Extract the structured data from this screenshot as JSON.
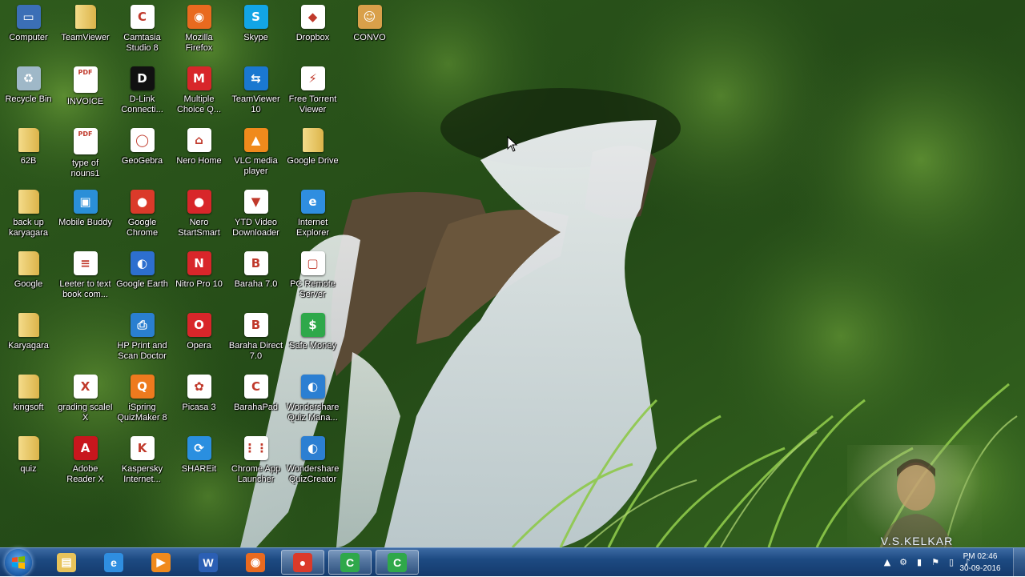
{
  "desktop": {
    "icons": [
      {
        "label": "Computer",
        "icon": "computer-icon",
        "color": "#3b6fb6",
        "glyph": "▭"
      },
      {
        "label": "TeamViewer",
        "icon": "folder-icon",
        "color": "#e8c35a",
        "glyph": ""
      },
      {
        "label": "Camtasia Studio 8",
        "icon": "camtasia-icon",
        "color": "#ffffff",
        "glyph": "C"
      },
      {
        "label": "Mozilla Firefox",
        "icon": "firefox-icon",
        "color": "#e96a1f",
        "glyph": "◉"
      },
      {
        "label": "Skype",
        "icon": "skype-icon",
        "color": "#12a5e6",
        "glyph": "S"
      },
      {
        "label": "Dropbox",
        "icon": "dropbox-icon",
        "color": "#ffffff",
        "glyph": "◆"
      },
      {
        "label": "CONVO",
        "icon": "photo-icon",
        "color": "#d9a04a",
        "glyph": "☺"
      },
      {
        "label": "Recycle Bin",
        "icon": "recycle-bin-icon",
        "color": "#9fb8c8",
        "glyph": "♻"
      },
      {
        "label": "INVOICE",
        "icon": "pdf-icon",
        "color": "#ffffff",
        "glyph": "PDF"
      },
      {
        "label": "D-Link Connecti...",
        "icon": "dlink-icon",
        "color": "#111111",
        "glyph": "D"
      },
      {
        "label": "Multiple Choice Q...",
        "icon": "quiz-icon",
        "color": "#d8262a",
        "glyph": "M"
      },
      {
        "label": "TeamViewer 10",
        "icon": "teamviewer-icon",
        "color": "#1a78d0",
        "glyph": "⇆"
      },
      {
        "label": "Free Torrent Viewer",
        "icon": "torrent-icon",
        "color": "#ffffff",
        "glyph": "⚡"
      },
      {
        "label": "",
        "icon": "",
        "color": "",
        "glyph": ""
      },
      {
        "label": "62B",
        "icon": "folder-icon",
        "color": "#e8c35a",
        "glyph": ""
      },
      {
        "label": "type of nouns1",
        "icon": "pdf-icon",
        "color": "#ffffff",
        "glyph": "PDF"
      },
      {
        "label": "GeoGebra",
        "icon": "geogebra-icon",
        "color": "#ffffff",
        "glyph": "◯"
      },
      {
        "label": "Nero Home",
        "icon": "nero-home-icon",
        "color": "#ffffff",
        "glyph": "⌂"
      },
      {
        "label": "VLC media player",
        "icon": "vlc-icon",
        "color": "#f08a1c",
        "glyph": "▲"
      },
      {
        "label": "Google Drive",
        "icon": "folder-icon",
        "color": "#e8c35a",
        "glyph": ""
      },
      {
        "label": "",
        "icon": "",
        "color": "",
        "glyph": ""
      },
      {
        "label": "back up karyagara",
        "icon": "folder-icon",
        "color": "#e8c35a",
        "glyph": ""
      },
      {
        "label": "Mobile Buddy",
        "icon": "mobile-buddy-icon",
        "color": "#2a8fd8",
        "glyph": "▣"
      },
      {
        "label": "Google Chrome",
        "icon": "chrome-icon",
        "color": "#db3a2a",
        "glyph": "●"
      },
      {
        "label": "Nero StartSmart",
        "icon": "nero-icon",
        "color": "#d8262a",
        "glyph": "●"
      },
      {
        "label": "YTD Video Downloader",
        "icon": "ytd-icon",
        "color": "#ffffff",
        "glyph": "▼"
      },
      {
        "label": "Internet Explorer",
        "icon": "ie-icon",
        "color": "#2f8ee0",
        "glyph": "e"
      },
      {
        "label": "",
        "icon": "",
        "color": "",
        "glyph": ""
      },
      {
        "label": "Google",
        "icon": "folder-icon",
        "color": "#e8c35a",
        "glyph": ""
      },
      {
        "label": "Leeter to text book com...",
        "icon": "document-icon",
        "color": "#ffffff",
        "glyph": "≡"
      },
      {
        "label": "Google Earth",
        "icon": "google-earth-icon",
        "color": "#2d6fcf",
        "glyph": "◐"
      },
      {
        "label": "Nitro Pro 10",
        "icon": "nitro-icon",
        "color": "#d8262a",
        "glyph": "N"
      },
      {
        "label": "Baraha 7.0",
        "icon": "baraha-icon",
        "color": "#ffffff",
        "glyph": "B"
      },
      {
        "label": "PC Remote Server",
        "icon": "pc-remote-icon",
        "color": "#ffffff",
        "glyph": "▢"
      },
      {
        "label": "",
        "icon": "",
        "color": "",
        "glyph": ""
      },
      {
        "label": "Karyagara",
        "icon": "folder-icon",
        "color": "#e8c35a",
        "glyph": ""
      },
      {
        "label": "",
        "icon": "",
        "color": "",
        "glyph": ""
      },
      {
        "label": "HP Print and Scan Doctor",
        "icon": "hp-icon",
        "color": "#2a7fd0",
        "glyph": "⎙"
      },
      {
        "label": "Opera",
        "icon": "opera-icon",
        "color": "#d8262a",
        "glyph": "O"
      },
      {
        "label": "Baraha Direct 7.0",
        "icon": "baraha-direct-icon",
        "color": "#ffffff",
        "glyph": "B"
      },
      {
        "label": "Safe Money",
        "icon": "safe-money-icon",
        "color": "#2ea84a",
        "glyph": "$"
      },
      {
        "label": "",
        "icon": "",
        "color": "",
        "glyph": ""
      },
      {
        "label": "kingsoft",
        "icon": "folder-icon",
        "color": "#e8c35a",
        "glyph": ""
      },
      {
        "label": "grading scaleI X",
        "icon": "excel-icon",
        "color": "#ffffff",
        "glyph": "X"
      },
      {
        "label": "iSpring QuizMaker 8",
        "icon": "ispring-icon",
        "color": "#ee7a1e",
        "glyph": "Q"
      },
      {
        "label": "Picasa 3",
        "icon": "picasa-icon",
        "color": "#ffffff",
        "glyph": "✿"
      },
      {
        "label": "BarahaPad",
        "icon": "barahapad-icon",
        "color": "#ffffff",
        "glyph": "C"
      },
      {
        "label": "Wondershare Quiz Mana...",
        "icon": "wondershare-icon",
        "color": "#2c7fd2",
        "glyph": "◐"
      },
      {
        "label": "",
        "icon": "",
        "color": "",
        "glyph": ""
      },
      {
        "label": "quiz",
        "icon": "folder-icon",
        "color": "#e8c35a",
        "glyph": ""
      },
      {
        "label": "Adobe Reader X",
        "icon": "adobe-reader-icon",
        "color": "#c8161d",
        "glyph": "A"
      },
      {
        "label": "Kaspersky Internet...",
        "icon": "kaspersky-icon",
        "color": "#ffffff",
        "glyph": "K"
      },
      {
        "label": "SHAREit",
        "icon": "shareit-icon",
        "color": "#2a8fe0",
        "glyph": "⟳"
      },
      {
        "label": "Chrome App Launcher",
        "icon": "app-launcher-icon",
        "color": "#ffffff",
        "glyph": "⋮⋮"
      },
      {
        "label": "Wondershare QuizCreator",
        "icon": "quizcreator-icon",
        "color": "#2c7fd2",
        "glyph": "◐"
      },
      {
        "label": "",
        "icon": "",
        "color": "",
        "glyph": ""
      }
    ]
  },
  "taskbar": {
    "pinned": [
      {
        "icon": "file-explorer-icon",
        "color": "#e8c35a",
        "glyph": "▤",
        "active": false
      },
      {
        "icon": "internet-explorer-icon",
        "color": "#2f8ee0",
        "glyph": "e",
        "active": false
      },
      {
        "icon": "media-player-icon",
        "color": "#f08a1c",
        "glyph": "▶",
        "active": false
      },
      {
        "icon": "word-icon",
        "color": "#2b5fb4",
        "glyph": "W",
        "active": false
      },
      {
        "icon": "firefox-icon",
        "color": "#e96a1f",
        "glyph": "◉",
        "active": false
      },
      {
        "icon": "chrome-icon",
        "color": "#db3a2a",
        "glyph": "●",
        "active": true
      },
      {
        "icon": "camtasia-recorder-icon",
        "color": "#2fa84a",
        "glyph": "C",
        "active": true
      },
      {
        "icon": "camtasia-studio-icon",
        "color": "#2fa84a",
        "glyph": "C",
        "active": true
      }
    ],
    "clock": {
      "time": "PM 02:46",
      "date": "30-09-2016"
    }
  },
  "overlay": {
    "webcam_label": "V.S.KELKAR"
  },
  "colors": {
    "taskbar": "#1d4a82",
    "wallpaper_water": "#e8eef2",
    "foliage": "#2f5a1e"
  }
}
